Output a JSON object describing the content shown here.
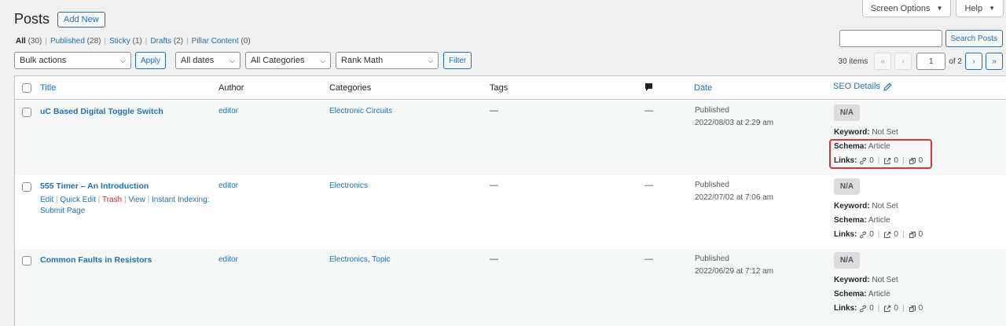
{
  "top_buttons": {
    "screen_options": "Screen Options",
    "help": "Help"
  },
  "page": {
    "title": "Posts",
    "add_new": "Add New"
  },
  "views": [
    {
      "label": "All",
      "count": "(30)",
      "current": true
    },
    {
      "label": "Published",
      "count": "(28)"
    },
    {
      "label": "Sticky",
      "count": "(1)"
    },
    {
      "label": "Drafts",
      "count": "(2)"
    },
    {
      "label": "Pillar Content",
      "count": "(0)"
    }
  ],
  "search": {
    "placeholder": "",
    "button": "Search Posts"
  },
  "filters": {
    "bulk_actions": "Bulk actions",
    "apply": "Apply",
    "dates": "All dates",
    "categories": "All Categories",
    "seo": "Rank Math",
    "filter": "Filter"
  },
  "pagination": {
    "items": "30 items",
    "first": "«",
    "prev": "‹",
    "current": "1",
    "of": "of 2",
    "next": "›",
    "last": "»"
  },
  "columns": {
    "title": "Title",
    "author": "Author",
    "categories": "Categories",
    "tags": "Tags",
    "date": "Date",
    "seo": "SEO Details"
  },
  "rows": [
    {
      "title": "uC Based Digital Toggle Switch",
      "author": "editor",
      "categories": "Electronic Circuits",
      "tags": "—",
      "comments": "—",
      "status": "Published",
      "date": "2022/08/03 at 2:29 am",
      "seo_score": "N/A",
      "keyword_label": "Keyword:",
      "keyword": "Not Set",
      "schema_label": "Schema:",
      "schema": "Article",
      "links_label": "Links:",
      "internal": "0",
      "external": "0",
      "incoming": "0"
    },
    {
      "title": "555 Timer – An Introduction",
      "author": "editor",
      "categories": "Electronics",
      "tags": "—",
      "comments": "—",
      "status": "Published",
      "date": "2022/07/02 at 7:06 am",
      "seo_score": "N/A",
      "keyword_label": "Keyword:",
      "keyword": "Not Set",
      "schema_label": "Schema:",
      "schema": "Article",
      "links_label": "Links:",
      "internal": "0",
      "external": "0",
      "incoming": "0",
      "actions": {
        "edit": "Edit",
        "quick_edit": "Quick Edit",
        "trash": "Trash",
        "view": "View",
        "instant": "Instant Indexing:",
        "submit": "Submit Page"
      }
    },
    {
      "title": "Common Faults in Resistors",
      "author": "editor",
      "categories": "Electronics, Topic",
      "tags": "—",
      "comments": "—",
      "status": "Published",
      "date": "2022/06/29 at 7:12 am",
      "seo_score": "N/A",
      "keyword_label": "Keyword:",
      "keyword": "Not Set",
      "schema_label": "Schema:",
      "schema": "Article",
      "links_label": "Links:",
      "internal": "0",
      "external": "0",
      "incoming": "0"
    }
  ],
  "colors": {
    "link": "#2271b1",
    "highlight": "#d63638",
    "trash": "#b32d2e"
  }
}
